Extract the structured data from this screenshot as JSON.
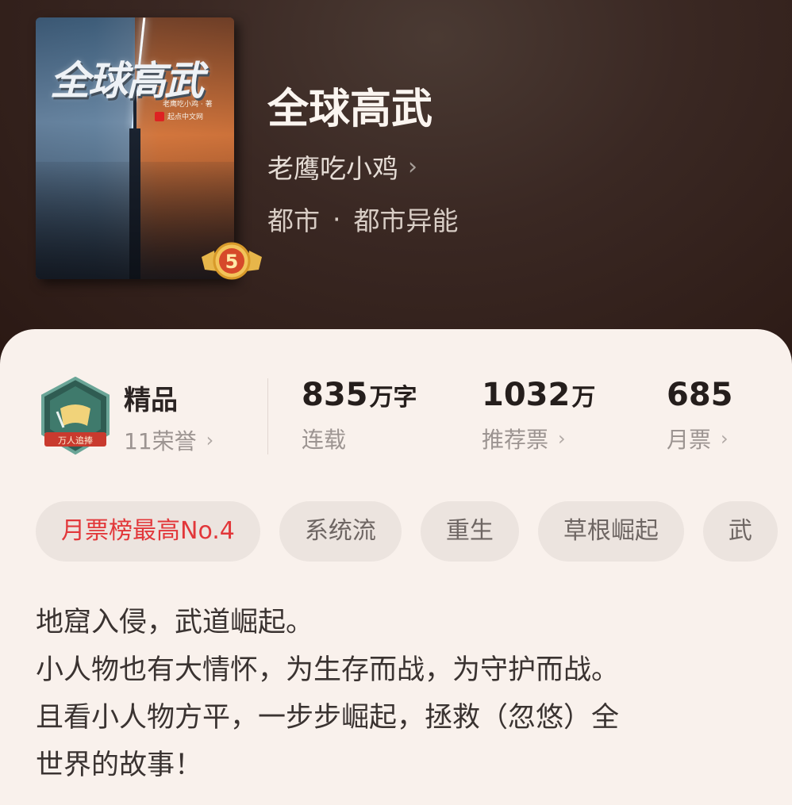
{
  "book": {
    "cover_title": "全球高武",
    "cover_author": "老鹰吃小鸡 · 著",
    "cover_publisher": "起点中文网",
    "level_badge": "5",
    "title": "全球高武",
    "author": "老鹰吃小鸡",
    "genre_main": "都市",
    "genre_dot": "·",
    "genre_sub": "都市异能"
  },
  "honor": {
    "badge_text": "万人追捧",
    "title": "精品",
    "subtitle": "11荣誉"
  },
  "stats": [
    {
      "value": "835",
      "unit": "万字",
      "label": "连载"
    },
    {
      "value": "1032",
      "unit": "万",
      "label": "推荐票"
    },
    {
      "value": "685",
      "unit": "",
      "label": "月票"
    }
  ],
  "tags": [
    "月票榜最高No.4",
    "系统流",
    "重生",
    "草根崛起",
    "武"
  ],
  "description": [
    "地窟入侵，武道崛起。",
    "小人物也有大情怀，为生存而战，为守护而战。",
    "且看小人物方平，一步步崛起，拯救（忽悠）全",
    "世界的故事！"
  ],
  "colors": {
    "hot_tag": "#e2373a",
    "panel_bg": "#f9f1ec",
    "hero_bg": "#3a2823"
  },
  "icons": {
    "chevron": "chevron-right-icon",
    "honor": "honor-medal-icon",
    "level": "level-5-badge-icon"
  }
}
